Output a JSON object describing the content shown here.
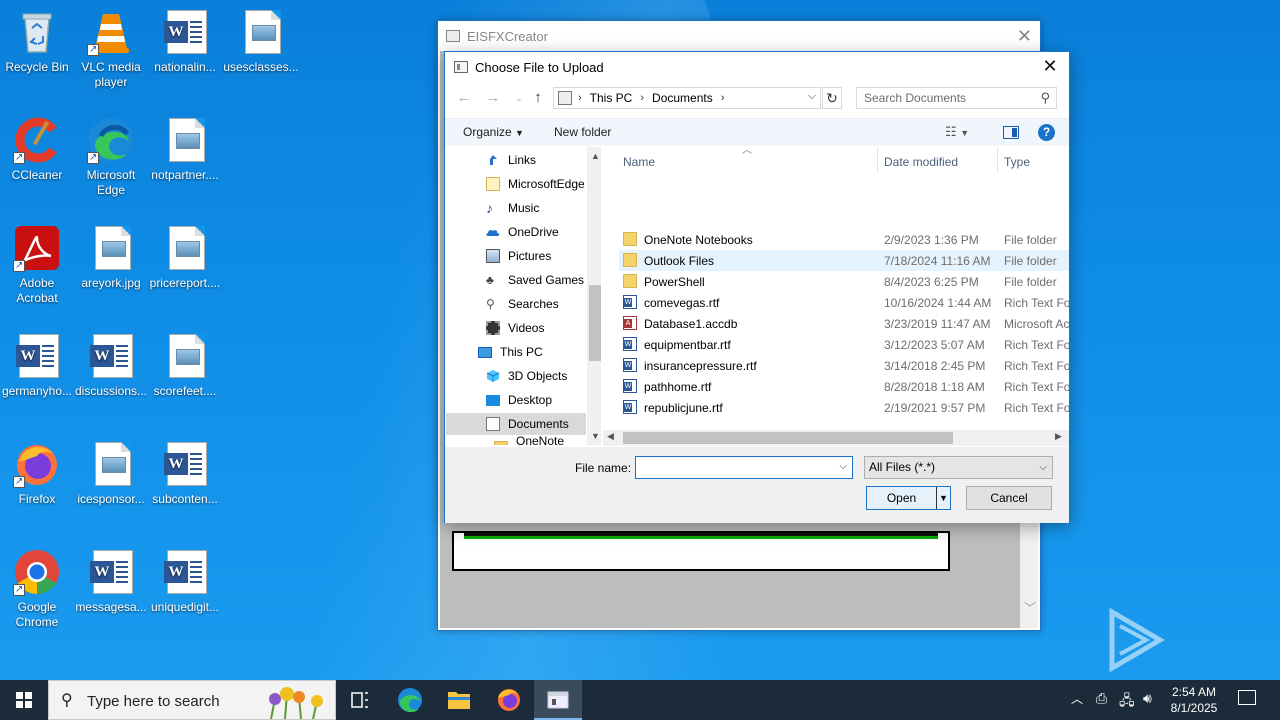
{
  "desktop": {
    "icons": [
      {
        "label": "Recycle Bin",
        "icon": "recycle-bin-icon"
      },
      {
        "label": "VLC media player",
        "icon": "vlc-icon"
      },
      {
        "label": "nationalin...",
        "icon": "word-doc-icon"
      },
      {
        "label": "usesclasses...",
        "icon": "image-file-icon"
      },
      {
        "label": "CCleaner",
        "icon": "ccleaner-icon"
      },
      {
        "label": "Microsoft Edge",
        "icon": "edge-icon"
      },
      {
        "label": "notpartner....",
        "icon": "image-file-icon"
      },
      {
        "label": "Adobe Acrobat",
        "icon": "acrobat-icon"
      },
      {
        "label": "areyork.jpg",
        "icon": "image-file-icon"
      },
      {
        "label": "pricereport....",
        "icon": "image-file-icon"
      },
      {
        "label": "germanyho...",
        "icon": "word-doc-icon"
      },
      {
        "label": "discussions...",
        "icon": "word-doc-icon"
      },
      {
        "label": "scorefeet....",
        "icon": "image-file-icon"
      },
      {
        "label": "Firefox",
        "icon": "firefox-icon"
      },
      {
        "label": "icesponsor...",
        "icon": "image-file-icon"
      },
      {
        "label": "subconten...",
        "icon": "word-doc-icon"
      },
      {
        "label": "Google Chrome",
        "icon": "chrome-icon"
      },
      {
        "label": "messagesa...",
        "icon": "word-doc-icon"
      },
      {
        "label": "uniquedigit...",
        "icon": "word-doc-icon"
      }
    ]
  },
  "app_window": {
    "title": "EISFXCreator"
  },
  "dialog": {
    "title": "Choose File to Upload",
    "breadcrumb": [
      "This PC",
      "Documents"
    ],
    "search_placeholder": "Search Documents",
    "organize_label": "Organize",
    "new_folder_label": "New folder",
    "nav_items": [
      {
        "label": "Links",
        "icon": "links-icon"
      },
      {
        "label": "MicrosoftEdge",
        "icon": "folder-icon"
      },
      {
        "label": "Music",
        "icon": "music-icon"
      },
      {
        "label": "OneDrive",
        "icon": "onedrive-icon"
      },
      {
        "label": "Pictures",
        "icon": "pictures-icon"
      },
      {
        "label": "Saved Games",
        "icon": "saved-games-icon"
      },
      {
        "label": "Searches",
        "icon": "searches-icon"
      },
      {
        "label": "Videos",
        "icon": "videos-icon"
      },
      {
        "label": "This PC",
        "icon": "this-pc-icon"
      },
      {
        "label": "3D Objects",
        "icon": "3d-objects-icon"
      },
      {
        "label": "Desktop",
        "icon": "desktop-folder-icon"
      },
      {
        "label": "Documents",
        "icon": "documents-icon"
      },
      {
        "label": "OneNote Not",
        "icon": "folder-icon"
      }
    ],
    "columns": {
      "name": "Name",
      "date": "Date modified",
      "type": "Type"
    },
    "files": [
      {
        "name": "OneNote Notebooks",
        "date": "2/9/2023 1:36 PM",
        "type": "File folder",
        "kind": "folder"
      },
      {
        "name": "Outlook Files",
        "date": "7/18/2024 11:16 AM",
        "type": "File folder",
        "kind": "folder"
      },
      {
        "name": "PowerShell",
        "date": "8/4/2023 6:25 PM",
        "type": "File folder",
        "kind": "folder"
      },
      {
        "name": "comevegas.rtf",
        "date": "10/16/2024 1:44 AM",
        "type": "Rich Text For",
        "kind": "rtf"
      },
      {
        "name": "Database1.accdb",
        "date": "3/23/2019 11:47 AM",
        "type": "Microsoft Ac",
        "kind": "accdb"
      },
      {
        "name": "equipmentbar.rtf",
        "date": "3/12/2023 5:07 AM",
        "type": "Rich Text For",
        "kind": "rtf"
      },
      {
        "name": "insurancepressure.rtf",
        "date": "3/14/2018 2:45 PM",
        "type": "Rich Text For",
        "kind": "rtf"
      },
      {
        "name": "pathhome.rtf",
        "date": "8/28/2018 1:18 AM",
        "type": "Rich Text For",
        "kind": "rtf"
      },
      {
        "name": "republicjune.rtf",
        "date": "2/19/2021 9:57 PM",
        "type": "Rich Text For",
        "kind": "rtf"
      }
    ],
    "file_name_label": "File name:",
    "file_name_value": "",
    "filter_value": "All Files (*.*)",
    "open_label": "Open",
    "cancel_label": "Cancel"
  },
  "taskbar": {
    "search_placeholder": "Type here to search",
    "time": "2:54 AM",
    "date": "8/1/2025"
  },
  "watermark": "ANY RUN",
  "colors": {
    "accent": "#1a73c8",
    "desktop_bg": "#0f8de6",
    "taskbar_bg": "#1c2b3a",
    "selection": "#d9d9d9",
    "hover": "#e5f3ff"
  }
}
